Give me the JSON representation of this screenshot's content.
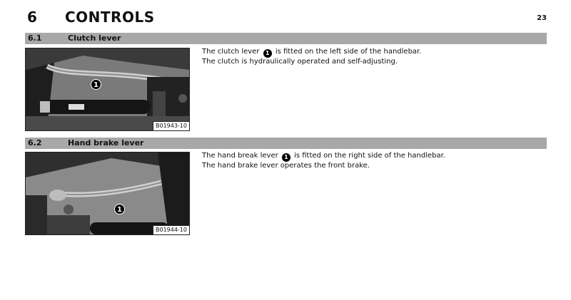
{
  "header": {
    "chapter_number": "6",
    "chapter_title": "CONTROLS",
    "page_number": "23"
  },
  "sections": [
    {
      "number": "6.1",
      "title": "Clutch lever",
      "figure_code": "B01943-10",
      "marker": "1",
      "line1_before": "The clutch lever",
      "line1_marker": "1",
      "line1_after": "is fitted on the left side of the handlebar.",
      "line2": "The clutch is hydraulically operated and self-adjusting."
    },
    {
      "number": "6.2",
      "title": "Hand brake lever",
      "figure_code": "B01944-10",
      "marker": "1",
      "line1_before": "The hand break lever",
      "line1_marker": "1",
      "line1_after": "is fitted on the right side of the handlebar.",
      "line2": "The hand brake lever operates the front brake."
    }
  ]
}
